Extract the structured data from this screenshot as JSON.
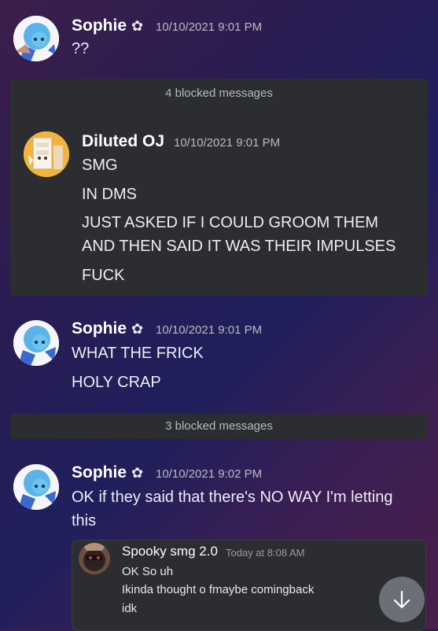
{
  "messages": [
    {
      "author": "Sophie",
      "flower": "✿",
      "timestamp": "10/10/2021 9:01 PM",
      "lines": [
        "??"
      ]
    },
    {
      "author": "Sophie",
      "flower": "✿",
      "timestamp": "10/10/2021 9:01 PM",
      "lines": [
        "WHAT THE FRICK",
        "HOLY CRAP"
      ]
    },
    {
      "author": "Sophie",
      "flower": "✿",
      "timestamp": "10/10/2021 9:02 PM",
      "lines": [
        "OK if they said that there's NO WAY I'm letting",
        "this"
      ]
    }
  ],
  "blocked_1": {
    "label": "4 blocked messages",
    "message": {
      "author": "Diluted OJ",
      "timestamp": "10/10/2021 9:01 PM",
      "lines": [
        "SMG",
        "IN DMS",
        "JUST ASKED IF I COULD GROOM THEM",
        "AND THEN SAID IT WAS THEIR IMPULSES",
        "FUCK"
      ]
    }
  },
  "blocked_2": {
    "label": "3 blocked messages"
  },
  "embed": {
    "author": "Spooky smg 2.0",
    "timestamp": "Today at 8:08 AM",
    "lines": [
      "OK So uh",
      "Ikinda thought o fmaybe comingback",
      "idk"
    ]
  },
  "icons": {
    "scroll_down": "arrow-down-icon",
    "flower": "flower-icon"
  },
  "colors": {
    "panel": "#2b2d31",
    "scroll_button": "#6b6f76"
  }
}
